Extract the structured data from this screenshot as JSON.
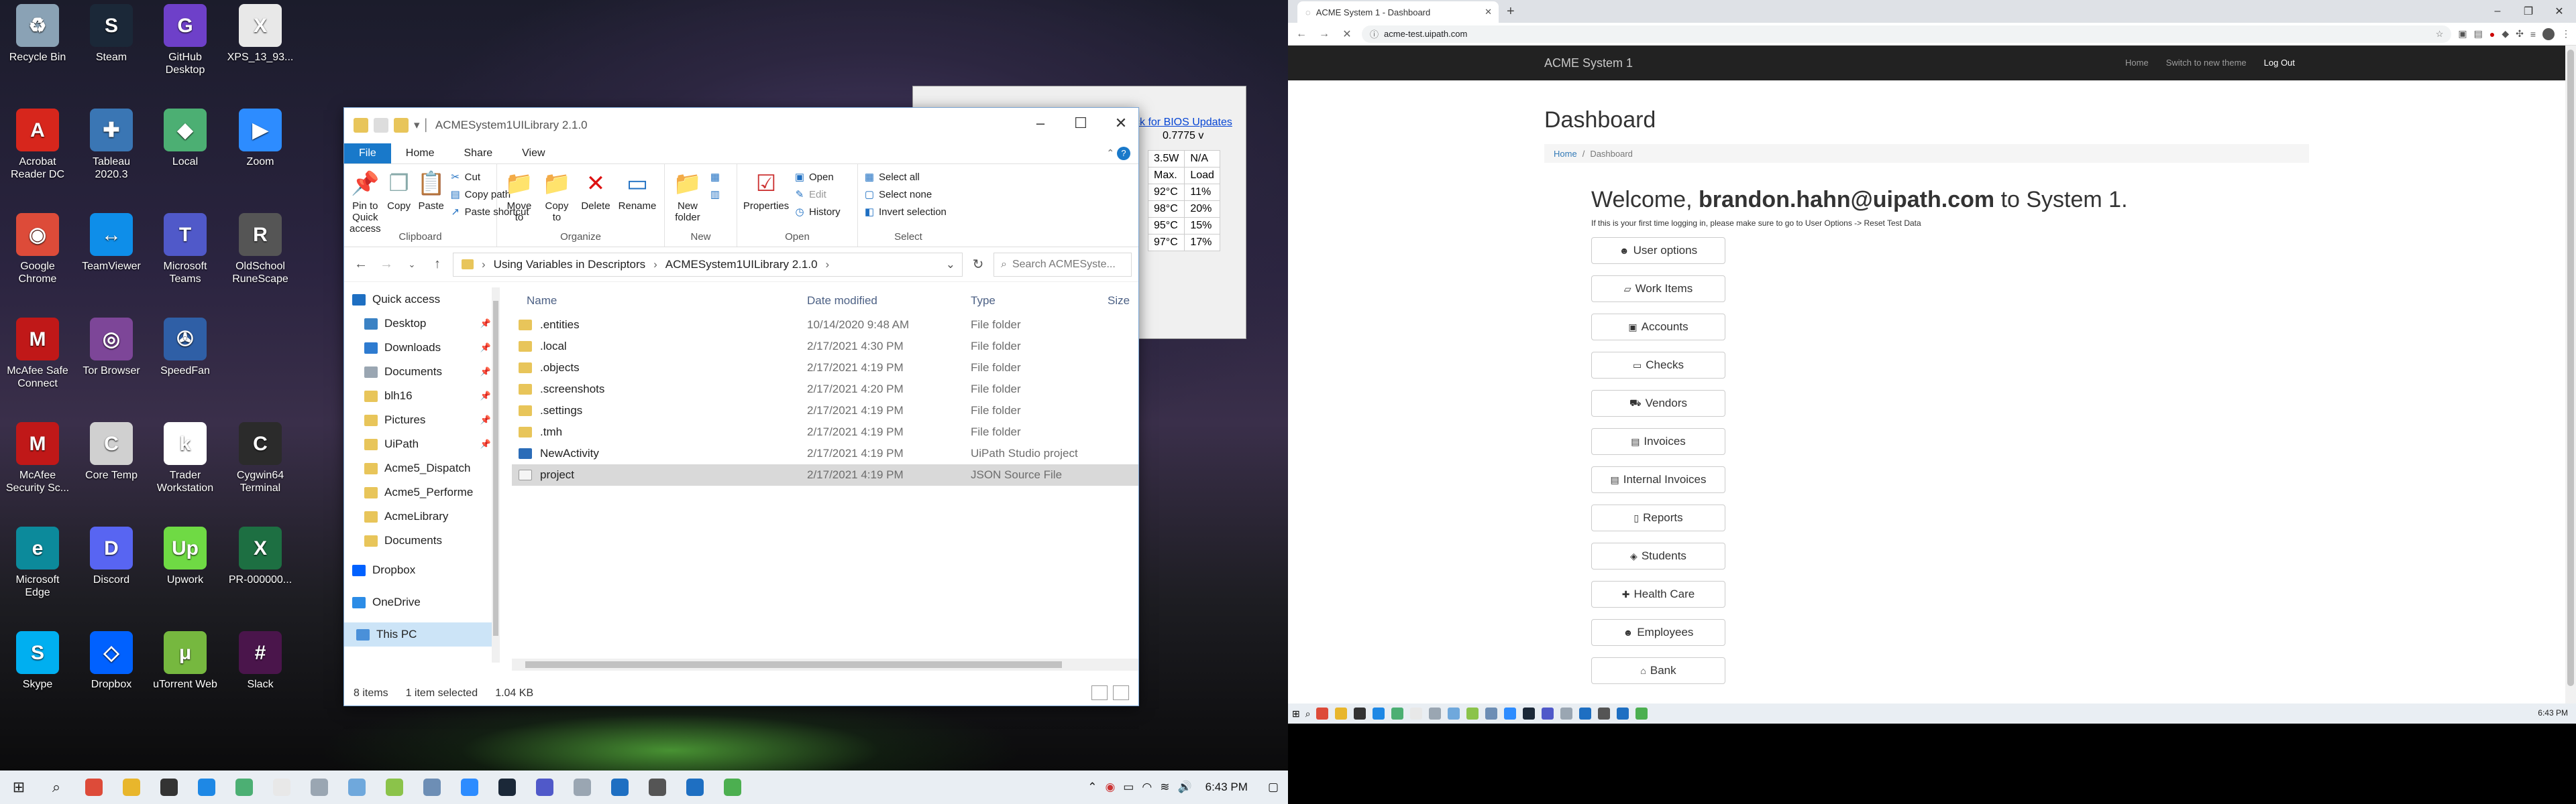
{
  "desktop": {
    "icons": [
      {
        "label": "Recycle Bin",
        "color": "#8aa2b5",
        "glyph": "♻"
      },
      {
        "label": "Steam",
        "color": "#1b2838",
        "glyph": "S"
      },
      {
        "label": "GitHub Desktop",
        "color": "#6e40c9",
        "glyph": "G"
      },
      {
        "label": "XPS_13_93...",
        "color": "#e8e8e8",
        "glyph": "X"
      },
      {
        "label": "Acrobat Reader DC",
        "color": "#d7261c",
        "glyph": "A"
      },
      {
        "label": "Tableau 2020.3",
        "color": "#3a76b4",
        "glyph": "✚"
      },
      {
        "label": "Local",
        "color": "#4caf73",
        "glyph": "◆"
      },
      {
        "label": "Zoom",
        "color": "#2d8cff",
        "glyph": "▶"
      },
      {
        "label": "Google Chrome",
        "color": "#dd4b39",
        "glyph": "◉"
      },
      {
        "label": "TeamViewer",
        "color": "#0e8ee9",
        "glyph": "↔"
      },
      {
        "label": "Microsoft Teams",
        "color": "#5059c9",
        "glyph": "T"
      },
      {
        "label": "OldSchool RuneScape",
        "color": "#555555",
        "glyph": "R"
      },
      {
        "label": "McAfee Safe Connect",
        "color": "#c01818",
        "glyph": "M"
      },
      {
        "label": "Tor Browser",
        "color": "#7d4698",
        "glyph": "◎"
      },
      {
        "label": "SpeedFan",
        "color": "#2f5fa6",
        "glyph": "✇"
      },
      {
        "label": "McAfee Security Sc...",
        "color": "#c01818",
        "glyph": "M"
      },
      {
        "label": "Core Temp",
        "color": "#d0d0d0",
        "glyph": "C"
      },
      {
        "label": "Trader Workstation",
        "color": "#ffffff",
        "glyph": "k"
      },
      {
        "label": "Cygwin64 Terminal",
        "color": "#2b2b2b",
        "glyph": "C"
      },
      {
        "label": "Microsoft Edge",
        "color": "#0c8a9b",
        "glyph": "e"
      },
      {
        "label": "Discord",
        "color": "#5865f2",
        "glyph": "D"
      },
      {
        "label": "Upwork",
        "color": "#6fda44",
        "glyph": "Up"
      },
      {
        "label": "PR-000000...",
        "color": "#1d6f42",
        "glyph": "X"
      },
      {
        "label": "Skype",
        "color": "#00aff0",
        "glyph": "S"
      },
      {
        "label": "Dropbox",
        "color": "#0061ff",
        "glyph": "◇"
      },
      {
        "label": "uTorrent Web",
        "color": "#76b83f",
        "glyph": "μ"
      },
      {
        "label": "Slack",
        "color": "#4a154b",
        "glyph": "#"
      }
    ]
  },
  "coretemp": {
    "link": "ck for BIOS Updates",
    "rows": [
      [
        "3.5W",
        "N/A"
      ],
      [
        "Max.",
        "Load"
      ],
      [
        "92°C",
        "11%"
      ],
      [
        "98°C",
        "20%"
      ],
      [
        "95°C",
        "15%"
      ],
      [
        "97°C",
        "17%"
      ]
    ],
    "volt": "0.7775 v"
  },
  "explorer": {
    "title": "ACMESystem1UILibrary 2.1.0",
    "ribbon_tabs": [
      "File",
      "Home",
      "Share",
      "View"
    ],
    "clipboard": {
      "pin": "Pin to Quick access",
      "copy": "Copy",
      "paste": "Paste",
      "cut": "Cut",
      "copy_path": "Copy path",
      "paste_shortcut": "Paste shortcut",
      "label": "Clipboard"
    },
    "organize": {
      "move_to": "Move to",
      "copy_to": "Copy to",
      "delete": "Delete",
      "rename": "Rename",
      "label": "Organize"
    },
    "new": {
      "new_folder": "New folder",
      "label": "New"
    },
    "open": {
      "properties": "Properties",
      "open": "Open",
      "edit": "Edit",
      "history": "History",
      "label": "Open"
    },
    "select": {
      "select_all": "Select all",
      "select_none": "Select none",
      "invert": "Invert selection",
      "label": "Select"
    },
    "path": [
      "Using Variables in Descriptors",
      "ACMESystem1UILibrary 2.1.0"
    ],
    "search_placeholder": "Search ACMESyste...",
    "nav": [
      {
        "label": "Quick access",
        "color": "#1e6fc2",
        "pin": false
      },
      {
        "label": "Desktop",
        "color": "#3b82c4",
        "pin": true
      },
      {
        "label": "Downloads",
        "color": "#2e7bd0",
        "pin": true
      },
      {
        "label": "Documents",
        "color": "#9aa6b2",
        "pin": true
      },
      {
        "label": "blh16",
        "color": "#e8c55a",
        "pin": true
      },
      {
        "label": "Pictures",
        "color": "#e8c55a",
        "pin": true
      },
      {
        "label": "UiPath",
        "color": "#e8c55a",
        "pin": true
      },
      {
        "label": "Acme5_Dispatch",
        "color": "#e8c55a",
        "pin": false
      },
      {
        "label": "Acme5_Performe",
        "color": "#e8c55a",
        "pin": false
      },
      {
        "label": "AcmeLibrary",
        "color": "#e8c55a",
        "pin": false
      },
      {
        "label": "Documents",
        "color": "#e8c55a",
        "pin": false
      },
      {
        "label": "Dropbox",
        "color": "#0061ff",
        "pin": false
      },
      {
        "label": "OneDrive",
        "color": "#2c8ce6",
        "pin": false
      },
      {
        "label": "This PC",
        "color": "#4a90d9",
        "pin": false
      }
    ],
    "columns": [
      "Name",
      "Date modified",
      "Type",
      "Size"
    ],
    "files": [
      {
        "name": ".entities",
        "date": "10/14/2020 9:48 AM",
        "type": "File folder",
        "color": "#e8c55a"
      },
      {
        "name": ".local",
        "date": "2/17/2021 4:30 PM",
        "type": "File folder",
        "color": "#e8c55a"
      },
      {
        "name": ".objects",
        "date": "2/17/2021 4:19 PM",
        "type": "File folder",
        "color": "#e8c55a"
      },
      {
        "name": ".screenshots",
        "date": "2/17/2021 4:20 PM",
        "type": "File folder",
        "color": "#e8c55a"
      },
      {
        "name": ".settings",
        "date": "2/17/2021 4:19 PM",
        "type": "File folder",
        "color": "#e8c55a"
      },
      {
        "name": ".tmh",
        "date": "2/17/2021 4:19 PM",
        "type": "File folder",
        "color": "#e8c55a"
      },
      {
        "name": "NewActivity",
        "date": "2/17/2021 4:19 PM",
        "type": "UiPath Studio project",
        "color": "#2b6cb8"
      },
      {
        "name": "project",
        "date": "2/17/2021 4:19 PM",
        "type": "JSON Source File",
        "color": "#f5f5f5"
      }
    ],
    "status": {
      "items": "8 items",
      "selected": "1 item selected",
      "size": "1.04 KB"
    }
  },
  "chrome": {
    "tab_title": "ACME System 1 - Dashboard",
    "url": "acme-test.uipath.com"
  },
  "acme": {
    "brand": "ACME System 1",
    "nav": [
      "Home",
      "Switch to new theme",
      "Log Out"
    ],
    "heading": "Dashboard",
    "breadcrumb": [
      "Home",
      "Dashboard"
    ],
    "welcome_pre": "Welcome,",
    "user": "brandon.hahn@uipath.com",
    "welcome_post": "to System 1.",
    "hint": "If this is your first time logging in, please make sure to go to User Options -> Reset Test Data",
    "buttons": [
      {
        "label": "User options",
        "icon": "☻"
      },
      {
        "label": "Work Items",
        "icon": "▱"
      },
      {
        "label": "Accounts",
        "icon": "▣"
      },
      {
        "label": "Checks",
        "icon": "▭"
      },
      {
        "label": "Vendors",
        "icon": "⛟"
      },
      {
        "label": "Invoices",
        "icon": "▤"
      },
      {
        "label": "Internal Invoices",
        "icon": "▤"
      },
      {
        "label": "Reports",
        "icon": "▯"
      },
      {
        "label": "Students",
        "icon": "◈"
      },
      {
        "label": "Health Care",
        "icon": "✚"
      },
      {
        "label": "Employees",
        "icon": "☻"
      },
      {
        "label": "Bank",
        "icon": "⌂"
      }
    ]
  },
  "taskbar": {
    "time_left": "6:43 PM",
    "time_right": "6:43 PM"
  }
}
